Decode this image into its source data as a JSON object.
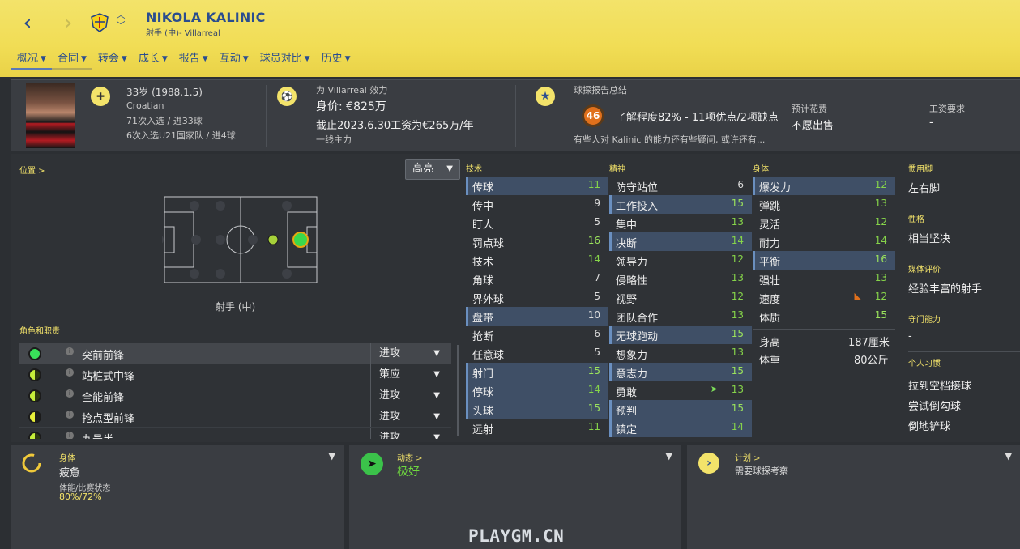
{
  "header": {
    "back_icon": "‹",
    "forward_icon": "›",
    "name": "NIKOLA KALINIC",
    "subtitle": "射手 (中)- Villarreal",
    "tabs": [
      {
        "label": "概况"
      },
      {
        "label": "合同"
      },
      {
        "label": "转会"
      },
      {
        "label": "成长"
      },
      {
        "label": "报告"
      },
      {
        "label": "互动"
      },
      {
        "label": "球员对比"
      },
      {
        "label": "历史"
      }
    ]
  },
  "info": {
    "age": "33岁 (1988.1.5)",
    "nationality": "Croatian",
    "caps": "71次入选 / 进33球",
    "u21": "6次入选U21国家队 / 进4球",
    "club_line": "为 Villarreal 效力",
    "value": "身价: €825万",
    "contract": "截止2023.6.30工资为€265万/年",
    "squad_status": "一线主力",
    "scout_title": "球探报告总结",
    "scout_ability": "46",
    "scout_summary": "了解程度82% - 11项优点/2项缺点",
    "scout_note": "有些人对 Kalinic 的能力还有些疑问, 或许还有...",
    "fee_label": "预计花费",
    "fee_value": "不愿出售",
    "wage_label": "工资要求",
    "wage_value": "-"
  },
  "position": {
    "label": "位置 >",
    "highlight_btn": "高亮",
    "name": "射手 (中)",
    "roles_label": "角色和职责",
    "roles": [
      {
        "name": "突前前锋",
        "duty": "进攻"
      },
      {
        "name": "站桩式中锋",
        "duty": "策应"
      },
      {
        "name": "全能前锋",
        "duty": "进攻"
      },
      {
        "name": "抢点型前锋",
        "duty": "进攻"
      },
      {
        "name": "九号半",
        "duty": "进攻"
      }
    ]
  },
  "attributes": {
    "technical_label": "技术",
    "mental_label": "精神",
    "physical_label": "身体",
    "technical": [
      {
        "name": "传球",
        "value": "11"
      },
      {
        "name": "传中",
        "value": "9"
      },
      {
        "name": "盯人",
        "value": "5"
      },
      {
        "name": "罚点球",
        "value": "16"
      },
      {
        "name": "技术",
        "value": "14"
      },
      {
        "name": "角球",
        "value": "7"
      },
      {
        "name": "界外球",
        "value": "5"
      },
      {
        "name": "盘带",
        "value": "10"
      },
      {
        "name": "抢断",
        "value": "6"
      },
      {
        "name": "任意球",
        "value": "5"
      },
      {
        "name": "射门",
        "value": "15"
      },
      {
        "name": "停球",
        "value": "14"
      },
      {
        "name": "头球",
        "value": "15"
      },
      {
        "name": "远射",
        "value": "11"
      }
    ],
    "mental": [
      {
        "name": "防守站位",
        "value": "6"
      },
      {
        "name": "工作投入",
        "value": "15"
      },
      {
        "name": "集中",
        "value": "13"
      },
      {
        "name": "决断",
        "value": "14"
      },
      {
        "name": "领导力",
        "value": "12"
      },
      {
        "name": "侵略性",
        "value": "13"
      },
      {
        "name": "视野",
        "value": "12"
      },
      {
        "name": "团队合作",
        "value": "13"
      },
      {
        "name": "无球跑动",
        "value": "15"
      },
      {
        "name": "想象力",
        "value": "13"
      },
      {
        "name": "意志力",
        "value": "15"
      },
      {
        "name": "勇敢",
        "value": "13"
      },
      {
        "name": "预判",
        "value": "15"
      },
      {
        "name": "镇定",
        "value": "14"
      }
    ],
    "physical": [
      {
        "name": "爆发力",
        "value": "12"
      },
      {
        "name": "弹跳",
        "value": "13"
      },
      {
        "name": "灵活",
        "value": "12"
      },
      {
        "name": "耐力",
        "value": "14"
      },
      {
        "name": "平衡",
        "value": "16"
      },
      {
        "name": "强壮",
        "value": "13"
      },
      {
        "name": "速度",
        "value": "12"
      },
      {
        "name": "体质",
        "value": "15"
      }
    ],
    "height_label": "身高",
    "height": "187厘米",
    "weight_label": "体重",
    "weight": "80公斤"
  },
  "right_col": {
    "foot_label": "惯用脚",
    "foot": "左右脚",
    "personality_label": "性格",
    "personality": "相当坚决",
    "media_label": "媒体评价",
    "media": "经验丰富的射手",
    "gk_label": "守门能力",
    "gk": "-",
    "habits_label": "个人习惯",
    "habits": [
      "拉到空档接球",
      "尝试倒勾球",
      "倒地铲球"
    ]
  },
  "cards": {
    "body_label": "身体",
    "body_state": "疲惫",
    "fitness_label": "体能/比赛状态",
    "fitness": "80%/72%",
    "dyn_label": "动态 >",
    "dyn_state": "极好",
    "plan_label": "计划 >",
    "plan_state": "需要球探考察"
  },
  "watermark": "PLAYGM.CN",
  "colors": {
    "header": "#f1dd55",
    "accent_blue": "#2a4d8f",
    "good": "#86d44a",
    "label_yellow": "#f3e36a"
  }
}
